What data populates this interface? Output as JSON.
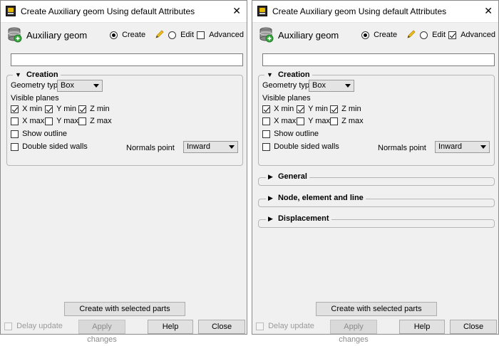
{
  "windows": [
    {
      "title": "Create Auxiliary geom Using default Attributes",
      "close": "✕",
      "header": {
        "title": "Auxiliary geom",
        "create": "Create",
        "edit": "Edit",
        "advanced": "Advanced",
        "advanced_checked": false
      },
      "creation": {
        "label": "Creation",
        "geometry_type_label": "Geometry type",
        "geometry_type_value": "Box",
        "visible_planes_label": "Visible planes",
        "x_min": "X min",
        "y_min": "Y min",
        "z_min": "Z min",
        "x_max": "X max",
        "y_max": "Y max",
        "z_max": "Z max",
        "show_outline": "Show outline",
        "double_sided_walls": "Double sided walls",
        "normals_point_label": "Normals point",
        "normals_point_value": "Inward"
      },
      "footer": {
        "create_selected": "Create with selected parts",
        "delay_update": "Delay update",
        "apply_changes": "Apply changes",
        "help": "Help",
        "close": "Close"
      }
    },
    {
      "title": "Create Auxiliary geom Using default Attributes",
      "close": "✕",
      "header": {
        "title": "Auxiliary geom",
        "create": "Create",
        "edit": "Edit",
        "advanced": "Advanced",
        "advanced_checked": true
      },
      "creation": {
        "label": "Creation",
        "geometry_type_label": "Geometry type",
        "geometry_type_value": "Box",
        "visible_planes_label": "Visible planes",
        "x_min": "X min",
        "y_min": "Y min",
        "z_min": "Z min",
        "x_max": "X max",
        "y_max": "Y max",
        "z_max": "Z max",
        "show_outline": "Show outline",
        "double_sided_walls": "Double sided walls",
        "normals_point_label": "Normals point",
        "normals_point_value": "Inward"
      },
      "sections": [
        "General",
        "Node, element and line",
        "Displacement"
      ],
      "footer": {
        "create_selected": "Create with selected parts",
        "delay_update": "Delay update",
        "apply_changes": "Apply changes",
        "help": "Help",
        "close": "Close"
      }
    }
  ]
}
